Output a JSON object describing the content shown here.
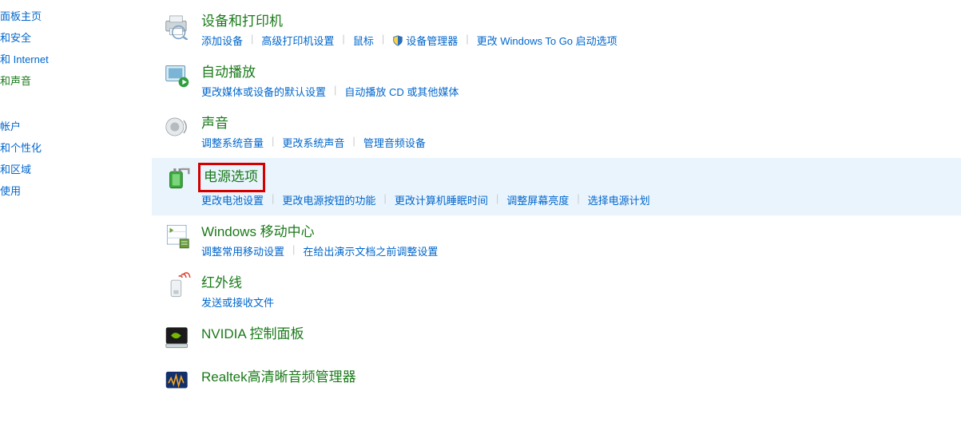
{
  "sidebar": {
    "group1": [
      {
        "label": "面板主页"
      },
      {
        "label": "和安全"
      },
      {
        "label": "和 Internet"
      },
      {
        "label": "和声音",
        "active": true
      }
    ],
    "group2": [
      {
        "label": "帐户"
      },
      {
        "label": "和个性化"
      },
      {
        "label": "和区域"
      },
      {
        "label": "使用"
      }
    ]
  },
  "categories": [
    {
      "icon": "printer-icon",
      "title": "设备和打印机",
      "links": [
        {
          "label": "添加设备"
        },
        {
          "label": "高级打印机设置"
        },
        {
          "label": "鼠标"
        },
        {
          "label": "设备管理器",
          "shield": true
        },
        {
          "label": "更改 Windows To Go 启动选项"
        }
      ]
    },
    {
      "icon": "autoplay-icon",
      "title": "自动播放",
      "links": [
        {
          "label": "更改媒体或设备的默认设置"
        },
        {
          "label": "自动播放 CD 或其他媒体"
        }
      ]
    },
    {
      "icon": "sound-icon",
      "title": "声音",
      "links": [
        {
          "label": "调整系统音量"
        },
        {
          "label": "更改系统声音"
        },
        {
          "label": "管理音频设备"
        }
      ]
    },
    {
      "icon": "power-icon",
      "title": "电源选项",
      "highlight": true,
      "boxed": true,
      "links": [
        {
          "label": "更改电池设置"
        },
        {
          "label": "更改电源按钮的功能"
        },
        {
          "label": "更改计算机睡眠时间"
        },
        {
          "label": "调整屏幕亮度"
        },
        {
          "label": "选择电源计划"
        }
      ]
    },
    {
      "icon": "mobility-icon",
      "title": "Windows 移动中心",
      "links": [
        {
          "label": "调整常用移动设置"
        },
        {
          "label": "在给出演示文档之前调整设置"
        }
      ]
    },
    {
      "icon": "infrared-icon",
      "title": "红外线",
      "links": [
        {
          "label": "发送或接收文件"
        }
      ]
    },
    {
      "icon": "nvidia-icon",
      "title": "NVIDIA 控制面板",
      "links": []
    },
    {
      "icon": "realtek-icon",
      "title": "Realtek高清晰音频管理器",
      "links": []
    }
  ]
}
